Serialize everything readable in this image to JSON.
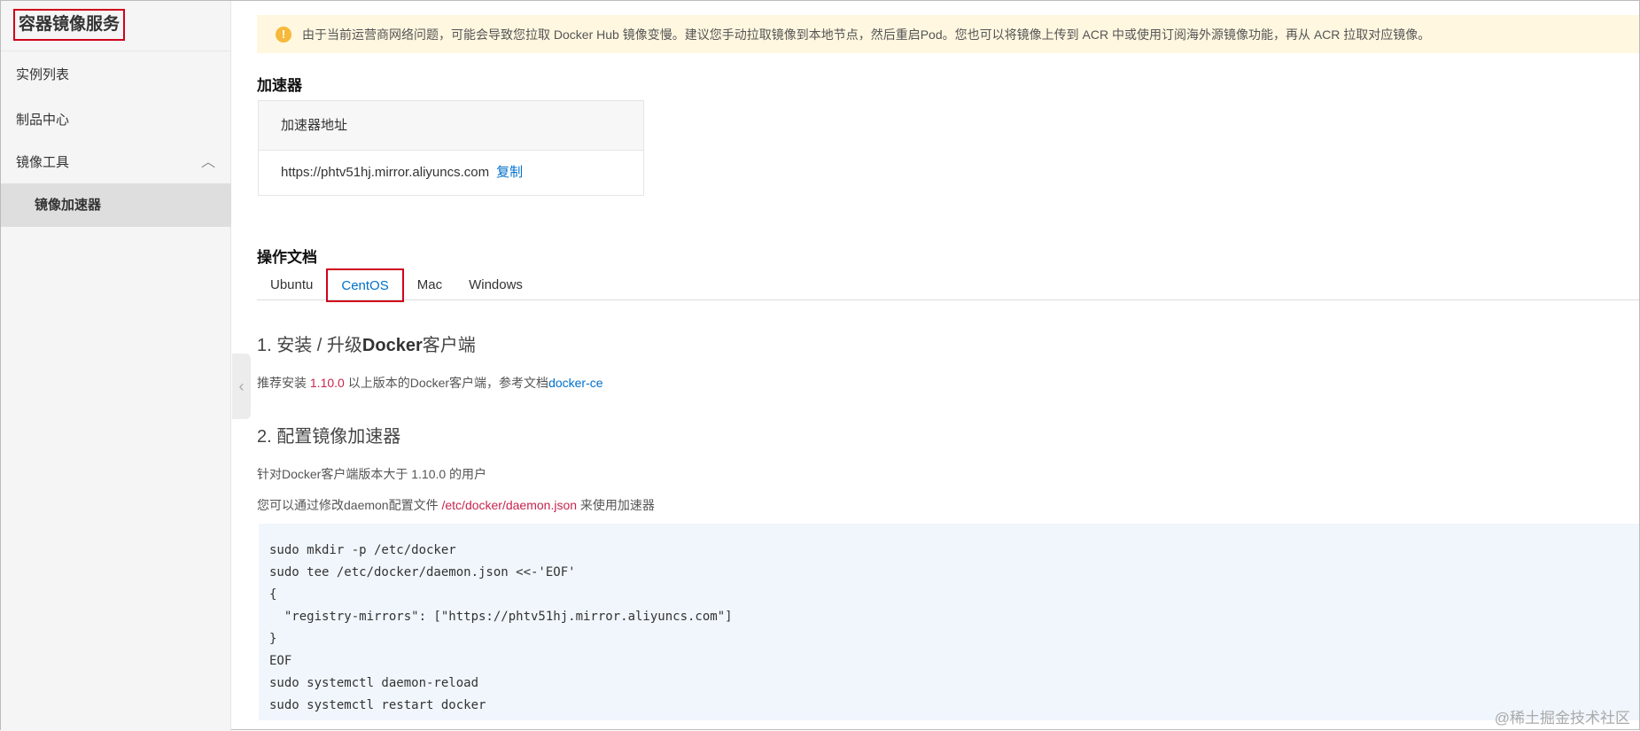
{
  "sidebar": {
    "title": "容器镜像服务",
    "items": [
      "实例列表",
      "制品中心",
      "镜像工具"
    ],
    "sub_item": "镜像加速器"
  },
  "alert": "由于当前运营商网络问题，可能会导致您拉取 Docker Hub 镜像变慢。建议您手动拉取镜像到本地节点，然后重启Pod。您也可以将镜像上传到 ACR 中或使用订阅海外源镜像功能，再从 ACR 拉取对应镜像。",
  "accelerator": {
    "heading": "加速器",
    "col_header": "加速器地址",
    "url": "https://phtv51hj.mirror.aliyuncs.com",
    "copy": "复制"
  },
  "docs": {
    "heading": "操作文档",
    "tabs": [
      "Ubuntu",
      "CentOS",
      "Mac",
      "Windows"
    ],
    "active_tab": "CentOS"
  },
  "step1": {
    "num": "1. ",
    "t1": "安装 / 升级",
    "t2": "Docker",
    "t3": "客户端",
    "p_pre": "推荐安装 ",
    "version": "1.10.0",
    "p_mid": " 以上版本的Docker客户端，参考文档",
    "link": "docker-ce"
  },
  "step2": {
    "title": "2. 配置镜像加速器",
    "p1": "针对Docker客户端版本大于 1.10.0 的用户",
    "p2_pre": "您可以通过修改daemon配置文件 ",
    "path": "/etc/docker/daemon.json",
    "p2_post": " 来使用加速器"
  },
  "code": [
    "sudo mkdir -p /etc/docker",
    "sudo tee /etc/docker/daemon.json <<-'EOF'",
    "{",
    "  \"registry-mirrors\": [\"https://phtv51hj.mirror.aliyuncs.com\"]",
    "}",
    "EOF",
    "sudo systemctl daemon-reload",
    "sudo systemctl restart docker"
  ],
  "watermark": "@稀土掘金技术社区"
}
